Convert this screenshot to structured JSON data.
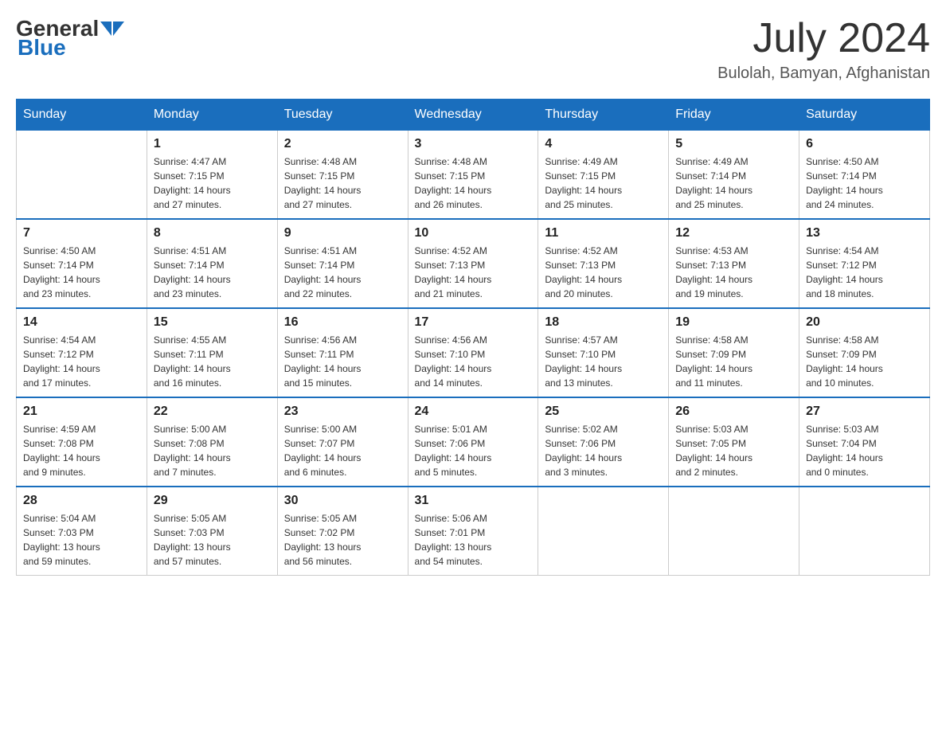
{
  "header": {
    "logo_general": "General",
    "logo_blue": "Blue",
    "month_title": "July 2024",
    "location": "Bulolah, Bamyan, Afghanistan"
  },
  "weekdays": [
    "Sunday",
    "Monday",
    "Tuesday",
    "Wednesday",
    "Thursday",
    "Friday",
    "Saturday"
  ],
  "weeks": [
    [
      {
        "day": "",
        "info": ""
      },
      {
        "day": "1",
        "info": "Sunrise: 4:47 AM\nSunset: 7:15 PM\nDaylight: 14 hours\nand 27 minutes."
      },
      {
        "day": "2",
        "info": "Sunrise: 4:48 AM\nSunset: 7:15 PM\nDaylight: 14 hours\nand 27 minutes."
      },
      {
        "day": "3",
        "info": "Sunrise: 4:48 AM\nSunset: 7:15 PM\nDaylight: 14 hours\nand 26 minutes."
      },
      {
        "day": "4",
        "info": "Sunrise: 4:49 AM\nSunset: 7:15 PM\nDaylight: 14 hours\nand 25 minutes."
      },
      {
        "day": "5",
        "info": "Sunrise: 4:49 AM\nSunset: 7:14 PM\nDaylight: 14 hours\nand 25 minutes."
      },
      {
        "day": "6",
        "info": "Sunrise: 4:50 AM\nSunset: 7:14 PM\nDaylight: 14 hours\nand 24 minutes."
      }
    ],
    [
      {
        "day": "7",
        "info": "Sunrise: 4:50 AM\nSunset: 7:14 PM\nDaylight: 14 hours\nand 23 minutes."
      },
      {
        "day": "8",
        "info": "Sunrise: 4:51 AM\nSunset: 7:14 PM\nDaylight: 14 hours\nand 23 minutes."
      },
      {
        "day": "9",
        "info": "Sunrise: 4:51 AM\nSunset: 7:14 PM\nDaylight: 14 hours\nand 22 minutes."
      },
      {
        "day": "10",
        "info": "Sunrise: 4:52 AM\nSunset: 7:13 PM\nDaylight: 14 hours\nand 21 minutes."
      },
      {
        "day": "11",
        "info": "Sunrise: 4:52 AM\nSunset: 7:13 PM\nDaylight: 14 hours\nand 20 minutes."
      },
      {
        "day": "12",
        "info": "Sunrise: 4:53 AM\nSunset: 7:13 PM\nDaylight: 14 hours\nand 19 minutes."
      },
      {
        "day": "13",
        "info": "Sunrise: 4:54 AM\nSunset: 7:12 PM\nDaylight: 14 hours\nand 18 minutes."
      }
    ],
    [
      {
        "day": "14",
        "info": "Sunrise: 4:54 AM\nSunset: 7:12 PM\nDaylight: 14 hours\nand 17 minutes."
      },
      {
        "day": "15",
        "info": "Sunrise: 4:55 AM\nSunset: 7:11 PM\nDaylight: 14 hours\nand 16 minutes."
      },
      {
        "day": "16",
        "info": "Sunrise: 4:56 AM\nSunset: 7:11 PM\nDaylight: 14 hours\nand 15 minutes."
      },
      {
        "day": "17",
        "info": "Sunrise: 4:56 AM\nSunset: 7:10 PM\nDaylight: 14 hours\nand 14 minutes."
      },
      {
        "day": "18",
        "info": "Sunrise: 4:57 AM\nSunset: 7:10 PM\nDaylight: 14 hours\nand 13 minutes."
      },
      {
        "day": "19",
        "info": "Sunrise: 4:58 AM\nSunset: 7:09 PM\nDaylight: 14 hours\nand 11 minutes."
      },
      {
        "day": "20",
        "info": "Sunrise: 4:58 AM\nSunset: 7:09 PM\nDaylight: 14 hours\nand 10 minutes."
      }
    ],
    [
      {
        "day": "21",
        "info": "Sunrise: 4:59 AM\nSunset: 7:08 PM\nDaylight: 14 hours\nand 9 minutes."
      },
      {
        "day": "22",
        "info": "Sunrise: 5:00 AM\nSunset: 7:08 PM\nDaylight: 14 hours\nand 7 minutes."
      },
      {
        "day": "23",
        "info": "Sunrise: 5:00 AM\nSunset: 7:07 PM\nDaylight: 14 hours\nand 6 minutes."
      },
      {
        "day": "24",
        "info": "Sunrise: 5:01 AM\nSunset: 7:06 PM\nDaylight: 14 hours\nand 5 minutes."
      },
      {
        "day": "25",
        "info": "Sunrise: 5:02 AM\nSunset: 7:06 PM\nDaylight: 14 hours\nand 3 minutes."
      },
      {
        "day": "26",
        "info": "Sunrise: 5:03 AM\nSunset: 7:05 PM\nDaylight: 14 hours\nand 2 minutes."
      },
      {
        "day": "27",
        "info": "Sunrise: 5:03 AM\nSunset: 7:04 PM\nDaylight: 14 hours\nand 0 minutes."
      }
    ],
    [
      {
        "day": "28",
        "info": "Sunrise: 5:04 AM\nSunset: 7:03 PM\nDaylight: 13 hours\nand 59 minutes."
      },
      {
        "day": "29",
        "info": "Sunrise: 5:05 AM\nSunset: 7:03 PM\nDaylight: 13 hours\nand 57 minutes."
      },
      {
        "day": "30",
        "info": "Sunrise: 5:05 AM\nSunset: 7:02 PM\nDaylight: 13 hours\nand 56 minutes."
      },
      {
        "day": "31",
        "info": "Sunrise: 5:06 AM\nSunset: 7:01 PM\nDaylight: 13 hours\nand 54 minutes."
      },
      {
        "day": "",
        "info": ""
      },
      {
        "day": "",
        "info": ""
      },
      {
        "day": "",
        "info": ""
      }
    ]
  ]
}
